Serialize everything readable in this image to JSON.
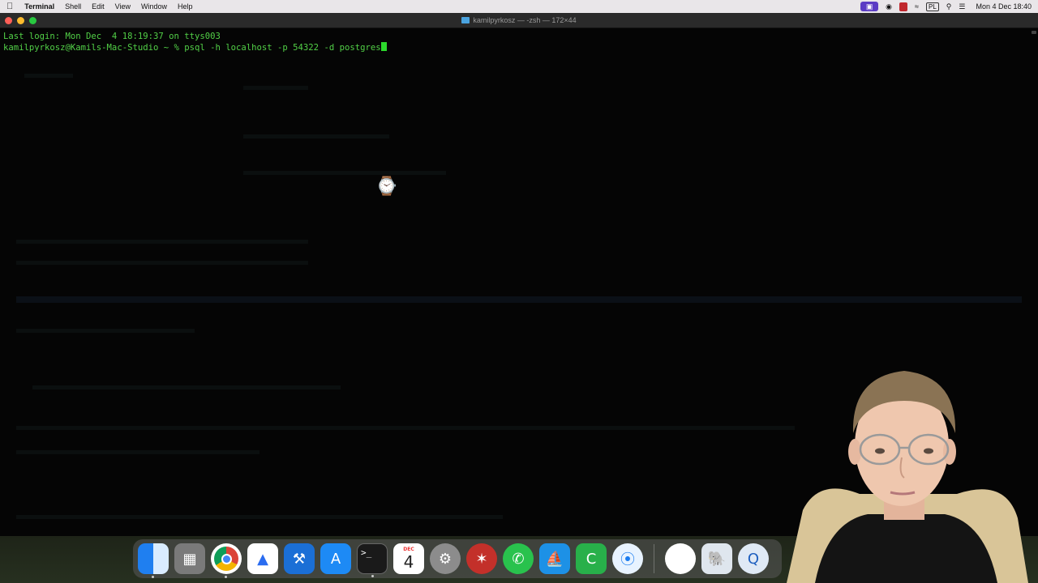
{
  "menubar": {
    "apple_icon": "apple-logo",
    "app_name": "Terminal",
    "items": [
      "Shell",
      "Edit",
      "View",
      "Window",
      "Help"
    ],
    "status_icons": [
      "screen-record-icon",
      "media-icon",
      "red-app-icon",
      "wifi-icon",
      "keyboard-layout-icon",
      "search-icon",
      "control-center-icon"
    ],
    "keyboard_layout": "PL",
    "clock": "Mon 4 Dec  18:40"
  },
  "window": {
    "title": "kamilpyrkosz — -zsh — 172×44"
  },
  "terminal": {
    "line1": "Last login: Mon Dec  4 18:19:37 on ttys003",
    "prompt": "kamilpyrkosz@Kamils-Mac-Studio ~ % ",
    "command": "psql -h localhost -p 54322 -d postgres"
  },
  "dock": {
    "apps": [
      "Finder",
      "Launchpad",
      "Google Chrome",
      "Instruments",
      "Xcode",
      "App Store",
      "Terminal",
      "Calendar",
      "System Settings",
      "Compass",
      "WhatsApp",
      "Docker",
      "Camtasia",
      "Safari",
      "Google Chrome",
      "Postgres",
      "QuickTime Player"
    ],
    "calendar_month": "DEC",
    "calendar_day": "4",
    "terminal_glyph": ">_"
  },
  "colors": {
    "terminal_text": "#52d047",
    "cursor": "#2cd92c",
    "menubar_bg": "#e9e6e9"
  }
}
